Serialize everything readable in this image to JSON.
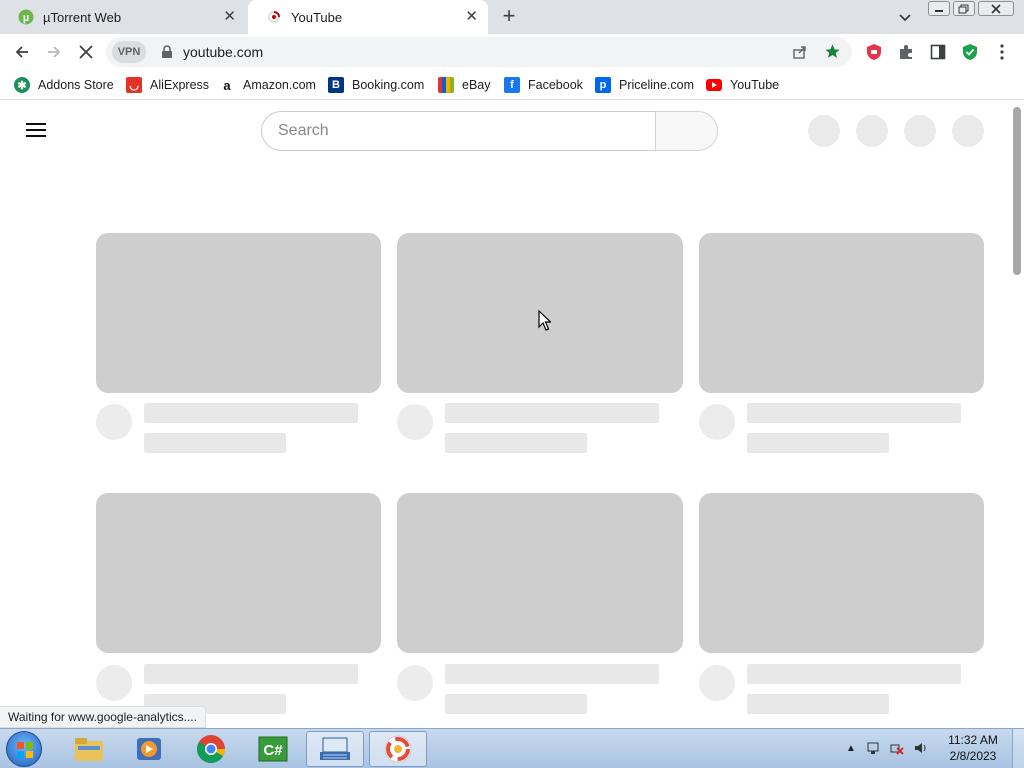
{
  "browser": {
    "tabs": [
      {
        "title": "µTorrent Web",
        "active": false
      },
      {
        "title": "YouTube",
        "active": true
      }
    ],
    "address": "youtube.com",
    "vpn_label": "VPN",
    "bookmarks": [
      {
        "label": "Addons Store",
        "icon": "addons-store-icon"
      },
      {
        "label": "AliExpress",
        "icon": "aliexpress-icon"
      },
      {
        "label": "Amazon.com",
        "icon": "amazon-icon"
      },
      {
        "label": "Booking.com",
        "icon": "booking-icon"
      },
      {
        "label": "eBay",
        "icon": "ebay-icon"
      },
      {
        "label": "Facebook",
        "icon": "facebook-icon"
      },
      {
        "label": "Priceline.com",
        "icon": "priceline-icon"
      },
      {
        "label": "YouTube",
        "icon": "youtube-icon"
      }
    ],
    "status_text": "Waiting for www.google-analytics...."
  },
  "page": {
    "search_placeholder": "Search",
    "skeleton_cards": 6
  },
  "taskbar": {
    "apps": [
      "windows-explorer-icon",
      "media-player-icon",
      "chrome-icon",
      "csharp-icon",
      "keyboard-app-icon",
      "browser-app-icon"
    ],
    "time": "11:32 AM",
    "date": "2/8/2023"
  },
  "colors": {
    "skeleton_thumb": "#cecece",
    "skeleton_line": "#e8e8e8",
    "youtube_red": "#ff0000",
    "tabstrip": "#dee1e6"
  }
}
